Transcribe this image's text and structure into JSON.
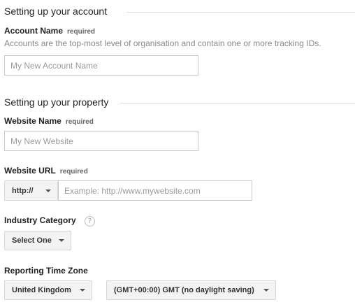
{
  "account_section": {
    "title": "Setting up your account",
    "account_name": {
      "label": "Account Name",
      "required": "required",
      "help": "Accounts are the top-most level of organisation and contain one or more tracking IDs.",
      "placeholder": "My New Account Name",
      "value": ""
    }
  },
  "property_section": {
    "title": "Setting up your property",
    "website_name": {
      "label": "Website Name",
      "required": "required",
      "placeholder": "My New Website",
      "value": ""
    },
    "website_url": {
      "label": "Website URL",
      "required": "required",
      "protocol": "http://",
      "placeholder": "Example: http://www.mywebsite.com",
      "value": ""
    },
    "industry_category": {
      "label": "Industry Category",
      "help_icon": "?",
      "selected": "Select One"
    },
    "reporting_time_zone": {
      "label": "Reporting Time Zone",
      "country": "United Kingdom",
      "zone": "(GMT+00:00) GMT (no daylight saving)"
    }
  }
}
